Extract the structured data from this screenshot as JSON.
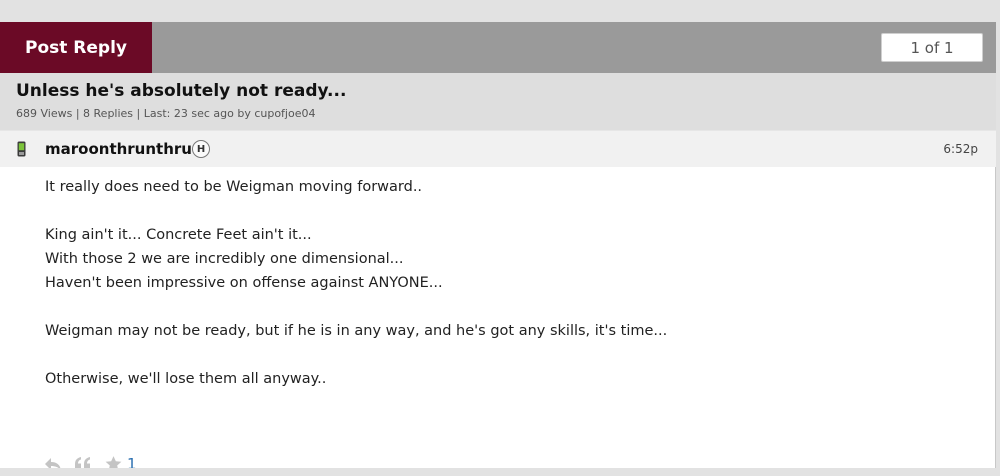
{
  "toolbar": {
    "post_reply_label": "Post Reply",
    "pager_label": "1 of 1"
  },
  "thread": {
    "title": "Unless he's absolutely not ready...",
    "meta": "689 Views | 8 Replies | Last: 23 sec ago by cupofjoe04"
  },
  "post": {
    "username": "maroonthrunthru",
    "badge": "H",
    "time": "6:52p",
    "lines": [
      "It really does need to be Weigman moving forward..",
      "",
      "King ain't it... Concrete Feet ain't it...",
      "With those 2 we are incredibly one dimensional...",
      "Haven't been impressive on offense against ANYONE...",
      "",
      "Weigman may not be ready, but if he is in any way, and he's got any skills, it's time...",
      "",
      "Otherwise, we'll lose them all anyway.."
    ],
    "star_count": "1"
  },
  "icons": {
    "device": "phone-icon",
    "reply": "reply-icon",
    "quote": "quote-icon",
    "star": "star-icon"
  },
  "colors": {
    "brand": "#6b0a26",
    "toolbar_bg": "#9a9a9a",
    "thread_head_bg": "#dedede",
    "post_head_bg": "#f1f1f1",
    "link": "#2a6fb0"
  }
}
